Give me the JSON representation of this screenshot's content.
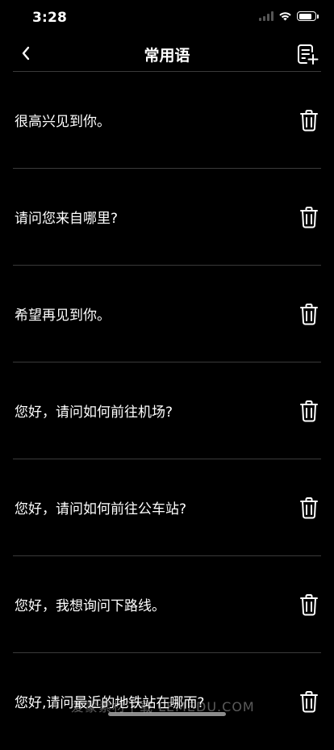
{
  "status_bar": {
    "time": "3:28",
    "battery_level": 0.85
  },
  "nav": {
    "title": "常用语",
    "back_icon": "chevron-left-icon",
    "action_icon": "note-add-icon"
  },
  "phrases": [
    {
      "text": "很高兴见到你。"
    },
    {
      "text": "请问您来自哪里?"
    },
    {
      "text": "希望再见到你。"
    },
    {
      "text": "您好，请问如何前往机场?"
    },
    {
      "text": "您好，请问如何前往公车站?"
    },
    {
      "text": "您好，我想询问下路线。"
    },
    {
      "text": "您好,请问最近的地铁站在哪而?"
    }
  ],
  "delete_icon": "trash-icon",
  "watermark": "爱蒙素材下载 LEMEDU.COM"
}
